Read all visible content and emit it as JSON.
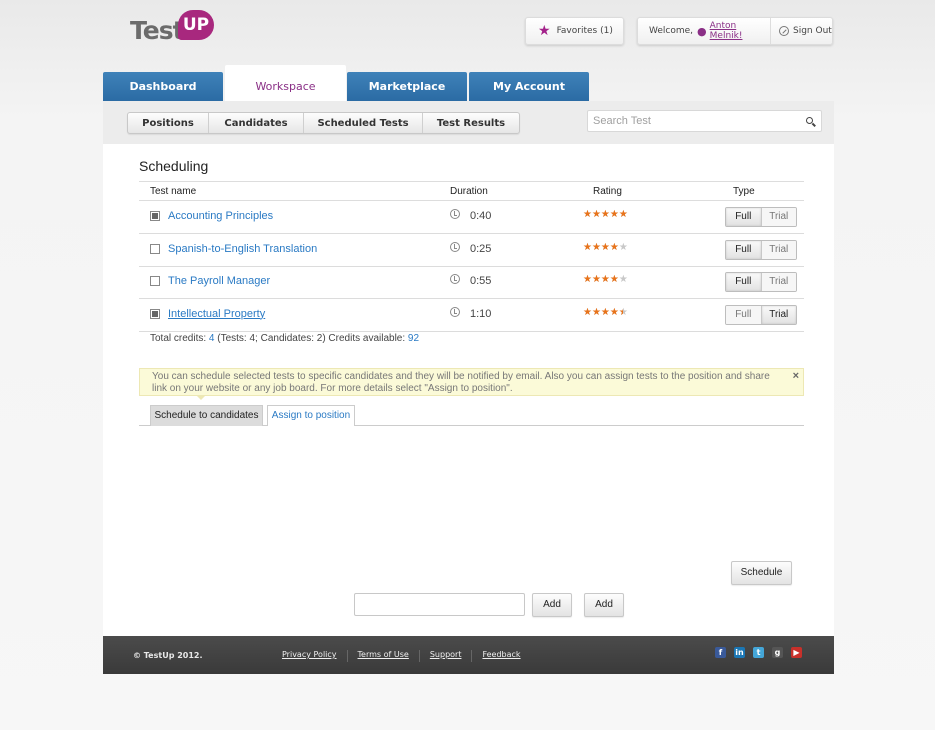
{
  "logo": {
    "text_main": "Test",
    "text_badge": "UP"
  },
  "top": {
    "favorites_label": "Favorites (1)",
    "welcome_prefix": "Welcome,",
    "user_name": "Anton Melnik!",
    "signout_label": "Sign Out"
  },
  "main_tabs": [
    {
      "label": "Dashboard",
      "active": false
    },
    {
      "label": "Workspace",
      "active": true
    },
    {
      "label": "Marketplace",
      "active": false
    },
    {
      "label": "My Account",
      "active": false
    }
  ],
  "sub_tabs": [
    {
      "label": "Positions"
    },
    {
      "label": "Candidates"
    },
    {
      "label": "Scheduled Tests"
    },
    {
      "label": "Test Results"
    }
  ],
  "search": {
    "placeholder": "Search Test"
  },
  "scheduling": {
    "title": "Scheduling",
    "columns": {
      "name": "Test name",
      "duration": "Duration",
      "rating": "Rating",
      "type": "Type"
    },
    "rows": [
      {
        "name": "Accounting Principles",
        "checked": true,
        "duration": "0:40",
        "rating": 5,
        "type": "Full",
        "underlined": false
      },
      {
        "name": "Spanish-to-English Translation",
        "checked": false,
        "duration": "0:25",
        "rating": 4,
        "type": "Full",
        "underlined": false
      },
      {
        "name": "The Payroll Manager",
        "checked": false,
        "duration": "0:55",
        "rating": 4,
        "type": "Full",
        "underlined": false
      },
      {
        "name": "Intellectual Property",
        "checked": true,
        "duration": "1:10",
        "rating": 4.5,
        "type": "Trial",
        "underlined": true
      }
    ],
    "type_options": {
      "full": "Full",
      "trial": "Trial"
    },
    "totals": {
      "prefix": "Total credits:",
      "total_credits": "4",
      "detail": "(Tests: 4; Candidates: 2) Credits available:",
      "credits_available": "92"
    }
  },
  "notice": {
    "text": "You can schedule selected tests to specific candidates and they will be notified by email. Also you can assign tests to the position and share link on your website or any job board. For more details select \"Assign to position\".",
    "close_glyph": "×"
  },
  "schedule_tabs": [
    {
      "label": "Schedule to candidates",
      "active": true
    },
    {
      "label": "Assign to position",
      "active": false
    }
  ],
  "actions": {
    "schedule_label": "Schedule",
    "add_input_value": "",
    "add_label_1": "Add",
    "add_label_2": "Add"
  },
  "footer": {
    "copyright": "© TestUp 2012.",
    "links": [
      "Privacy Policy",
      "Terms of Use",
      "Support",
      "Feedback"
    ],
    "social_icons": [
      "facebook-icon",
      "linkedin-icon",
      "twitter-icon",
      "google-plus-icon",
      "youtube-icon"
    ]
  },
  "colors": {
    "brand": "#a8287e",
    "tab_blue": "#2f74ae",
    "link_blue": "#2a7ac4",
    "star_orange": "#e8731a",
    "notice_bg": "#fbfad8"
  }
}
